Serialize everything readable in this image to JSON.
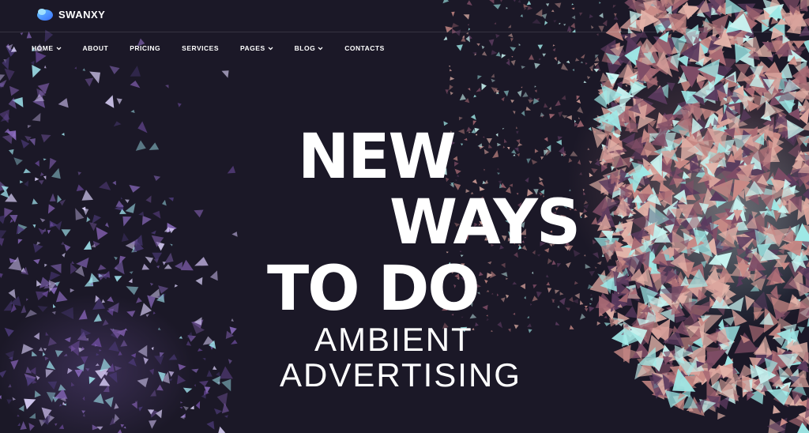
{
  "brand": {
    "name": "SWANXY"
  },
  "nav": {
    "items": [
      {
        "label": "HOME",
        "dropdown": true
      },
      {
        "label": "ABOUT",
        "dropdown": false
      },
      {
        "label": "PRICING",
        "dropdown": false
      },
      {
        "label": "SERVICES",
        "dropdown": false
      },
      {
        "label": "PAGES",
        "dropdown": true
      },
      {
        "label": "BLOG",
        "dropdown": true
      },
      {
        "label": "CONTACTS",
        "dropdown": false
      }
    ]
  },
  "hero": {
    "line1": "NEW",
    "line2": "WAYS",
    "line3": "TO DO",
    "line4": "AMBIENT",
    "line5": "ADVERTISING"
  },
  "colors": {
    "background": "#1b1827",
    "text": "#ffffff",
    "logo_accent": "#4fa3ff"
  }
}
